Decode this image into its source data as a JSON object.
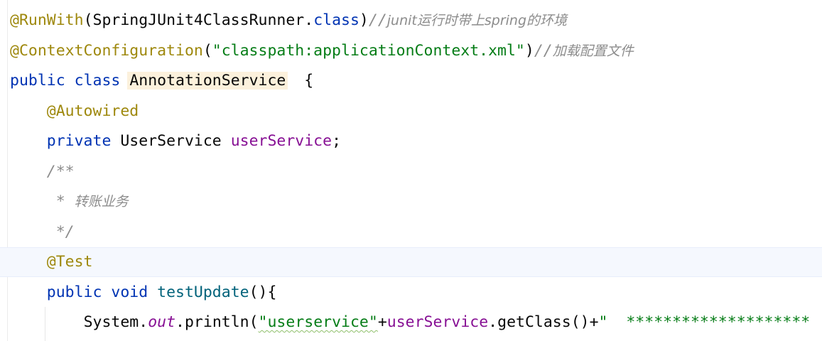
{
  "editor": {
    "lines": [
      {
        "annotation": "@RunWith",
        "open_paren": "(",
        "class_ref": "SpringJUnit4ClassRunner",
        "dot": ".",
        "class_kw": "class",
        "close_paren": ")",
        "comment_slashes": "//",
        "comment_text": "junit运行时带上spring的环境"
      },
      {
        "annotation": "@ContextConfiguration",
        "open_paren": "(",
        "string": "\"classpath:applicationContext.xml\"",
        "close_paren": ")",
        "comment_slashes": "//",
        "comment_text": "加载配置文件"
      },
      {
        "kw_public": "public",
        "kw_class": "class",
        "class_name": "AnnotationService",
        "brace": "{"
      },
      {
        "annotation": "@Autowired"
      },
      {
        "kw_private": "private",
        "type": "UserService",
        "field": "userService",
        "semicolon": ";"
      },
      {
        "doc_open": "/**"
      },
      {
        "doc_star": "*",
        "doc_text": "转账业务"
      },
      {
        "doc_close": "*/"
      },
      {
        "annotation": "@Test"
      },
      {
        "kw_public": "public",
        "kw_void": "void",
        "method": "testUpdate",
        "parens": "()",
        "brace": "{"
      },
      {
        "system": "System",
        "dot1": ".",
        "out": "out",
        "dot2": ".",
        "println": "println",
        "open_paren": "(",
        "string1": "\"userservice\"",
        "plus1": "+",
        "field": "userService",
        "dot3": ".",
        "getclass": "getClass",
        "call_parens": "()",
        "plus2": "+",
        "string2_start": "\"  ********************"
      }
    ]
  }
}
